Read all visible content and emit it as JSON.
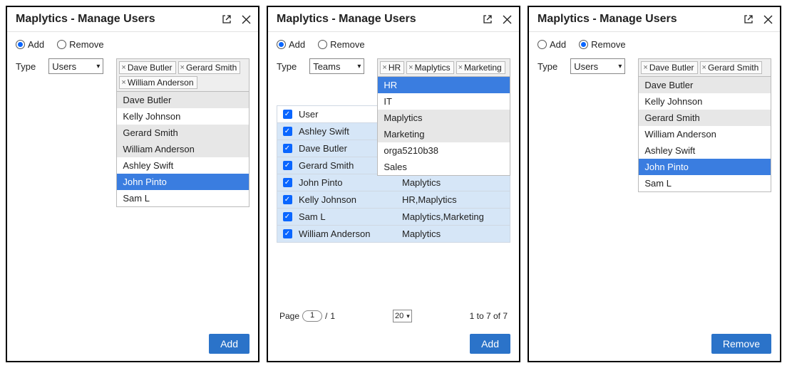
{
  "header": {
    "title": "Maplytics - Manage Users"
  },
  "radios": {
    "add": "Add",
    "remove": "Remove"
  },
  "type": {
    "label": "Type",
    "users": "Users",
    "teams": "Teams"
  },
  "panel1": {
    "chips": [
      "Dave Butler",
      "Gerard Smith",
      "William Anderson"
    ],
    "options": [
      "Dave Butler",
      "Kelly Johnson",
      "Gerard Smith",
      "William Anderson",
      "Ashley Swift",
      "John Pinto",
      "Sam L"
    ],
    "selectedOption": "John Pinto",
    "button": "Add"
  },
  "panel2": {
    "chips": [
      "HR",
      "Maplytics",
      "Marketing"
    ],
    "options": [
      "HR",
      "IT",
      "Maplytics",
      "Marketing",
      "orga5210b38",
      "Sales"
    ],
    "selectedOption": "HR",
    "table": {
      "headers": [
        "User",
        ""
      ],
      "rows": [
        {
          "user": "Ashley Swift",
          "teams": ""
        },
        {
          "user": "Dave Butler",
          "teams": ""
        },
        {
          "user": "Gerard Smith",
          "teams": ""
        },
        {
          "user": "John Pinto",
          "teams": "Maplytics"
        },
        {
          "user": "Kelly Johnson",
          "teams": "HR,Maplytics"
        },
        {
          "user": "Sam L",
          "teams": "Maplytics,Marketing"
        },
        {
          "user": "William Anderson",
          "teams": "Maplytics"
        }
      ]
    },
    "pager": {
      "page": "1",
      "total": "1",
      "size": "20",
      "range": "1 to 7 of 7",
      "pageLabel": "Page",
      "sep": "/"
    },
    "button": "Add"
  },
  "panel3": {
    "chips": [
      "Dave Butler",
      "Gerard Smith"
    ],
    "options": [
      "Dave Butler",
      "Kelly Johnson",
      "Gerard Smith",
      "William Anderson",
      "Ashley Swift",
      "John Pinto",
      "Sam L"
    ],
    "selectedOption": "John Pinto",
    "button": "Remove"
  }
}
